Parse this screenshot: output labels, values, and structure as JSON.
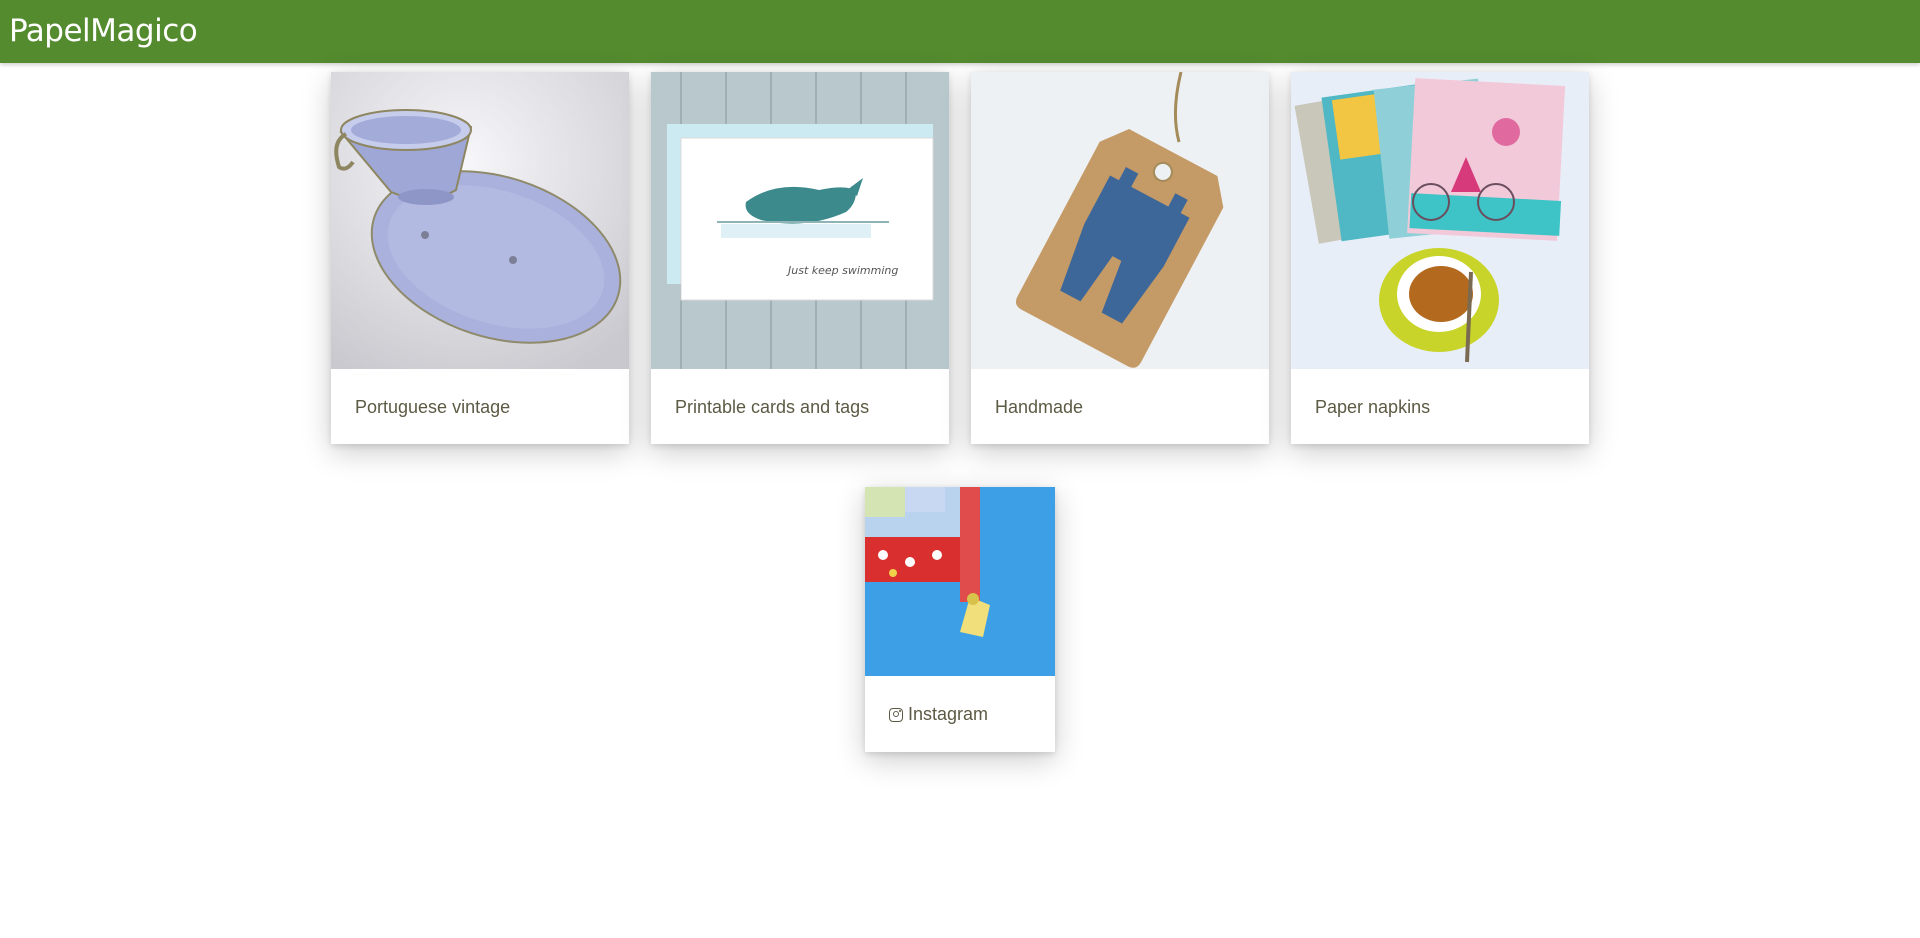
{
  "header": {
    "brand": "PapelMagico",
    "bar_color": "#548b2f"
  },
  "cards": [
    {
      "label": "Portuguese vintage",
      "image": "blue-porcelain-cup-and-plate"
    },
    {
      "label": "Printable cards and tags",
      "image": "whale-card-just-keep-swimming",
      "image_text": "Just keep swimming"
    },
    {
      "label": "Handmade",
      "image": "denim-overalls-kraft-tag"
    },
    {
      "label": "Paper napkins",
      "image": "floral-napkins-and-coffee-cup"
    }
  ],
  "social": {
    "label": "Instagram",
    "icon": "instagram-icon",
    "image": "patchwork-fabric-tassel"
  }
}
